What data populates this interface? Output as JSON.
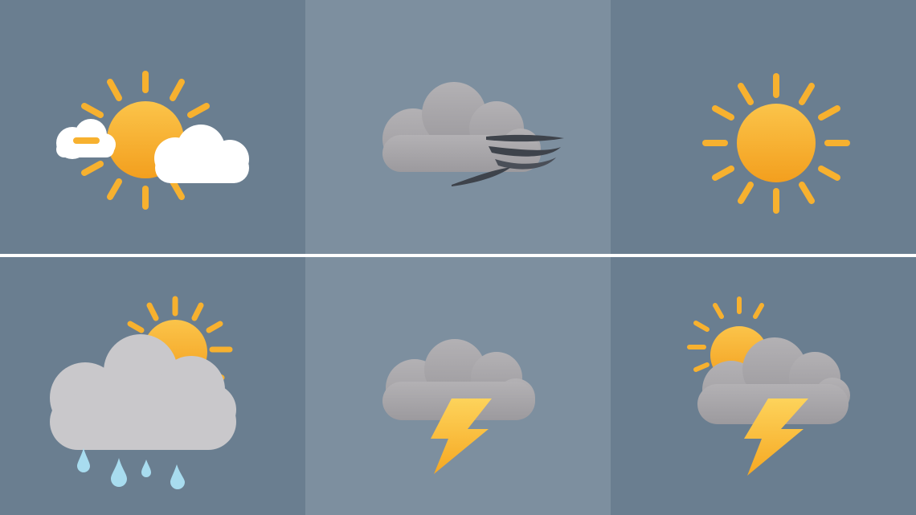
{
  "colors": {
    "tile_dark": "#6a7e90",
    "tile_light": "#7d8f9f",
    "divider": "#ffffff",
    "sun": "#f7b12f",
    "sun_core_top": "#fbc44a",
    "sun_core_bottom": "#f39f1e",
    "cloud_white": "#ffffff",
    "cloud_grey": "#a9a7aa",
    "cloud_grey_light": "#c9c8cb",
    "wind_dark": "#3e434b",
    "bolt": "#fbc02d",
    "rain": "#a8dcef"
  },
  "tiles": [
    {
      "icon": "sun-behind-clouds-icon",
      "condition": "partly-sunny"
    },
    {
      "icon": "windy-cloud-icon",
      "condition": "wind"
    },
    {
      "icon": "sun-icon",
      "condition": "sunny"
    },
    {
      "icon": "sun-cloud-rain-icon",
      "condition": "showers"
    },
    {
      "icon": "cloud-lightning-icon",
      "condition": "thunderstorm"
    },
    {
      "icon": "sun-cloud-lightning-icon",
      "condition": "scattered-thunderstorms"
    }
  ]
}
